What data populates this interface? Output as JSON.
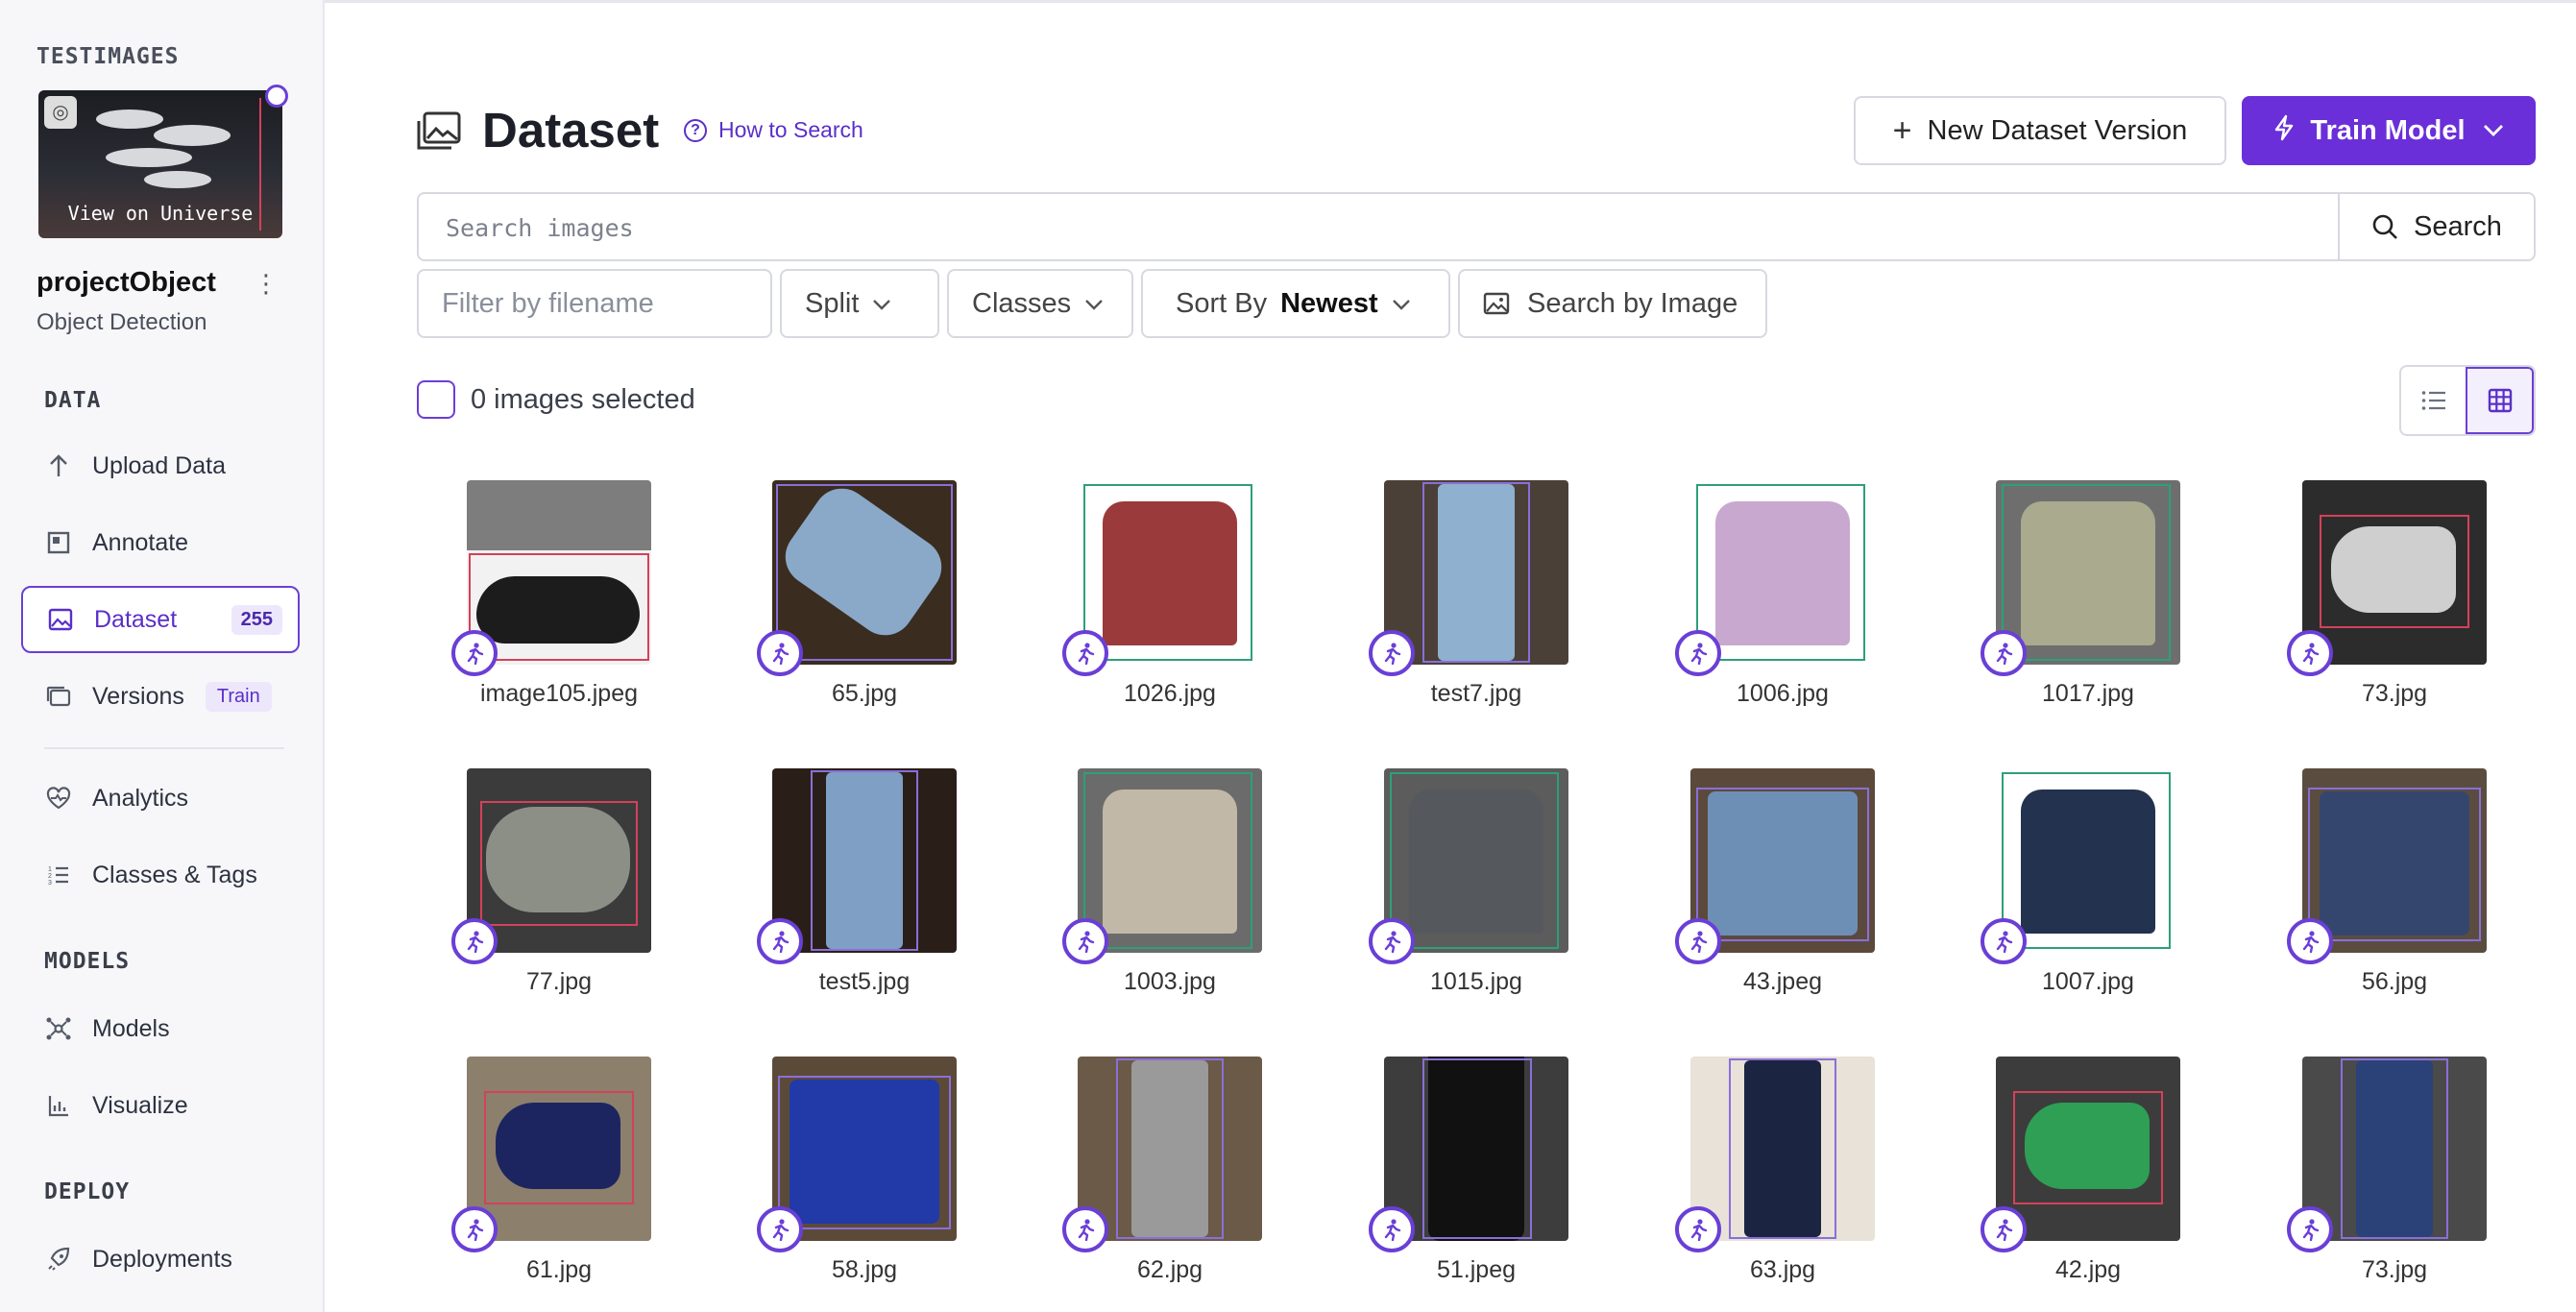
{
  "workspace": {
    "name": "TESTIMAGES",
    "view_label": "View on Universe"
  },
  "project": {
    "name": "projectObject",
    "type": "Object Detection"
  },
  "sidebar": {
    "sections": {
      "data": "DATA",
      "models": "MODELS",
      "deploy": "DEPLOY"
    },
    "items": [
      {
        "label": "Upload Data",
        "icon": "upload-icon"
      },
      {
        "label": "Annotate",
        "icon": "annotate-icon"
      },
      {
        "label": "Dataset",
        "icon": "dataset-icon",
        "badge": "255",
        "active": true
      },
      {
        "label": "Versions",
        "icon": "versions-icon",
        "badge": "Train"
      },
      {
        "label": "Analytics",
        "icon": "heartbeat-icon"
      },
      {
        "label": "Classes & Tags",
        "icon": "list-icon"
      },
      {
        "label": "Models",
        "icon": "network-icon"
      },
      {
        "label": "Visualize",
        "icon": "chart-icon"
      },
      {
        "label": "Deployments",
        "icon": "rocket-icon"
      }
    ]
  },
  "header": {
    "title": "Dataset",
    "help_link": "How to Search",
    "new_version_label": "New Dataset Version",
    "train_label": "Train Model"
  },
  "search": {
    "placeholder": "Search images",
    "button": "Search"
  },
  "filters": {
    "filename_placeholder": "Filter by filename",
    "split": "Split",
    "classes": "Classes",
    "sort_label": "Sort By",
    "sort_value": "Newest",
    "search_by_image": "Search by Image"
  },
  "selection": {
    "text": "0 images selected"
  },
  "accent_color": "#6a2fd9",
  "images": [
    {
      "name": "image105.jpeg",
      "bg": "#f2f2f2",
      "top": "#7d7d7d",
      "box": "#d4415a",
      "item": "#1c1c1c",
      "shape": "sandal"
    },
    {
      "name": "65.jpg",
      "bg": "#3a2c1e",
      "top": "#3a2c1e",
      "box": "#8a6fd8",
      "item": "#8aa8c8",
      "shape": "jeans-flat"
    },
    {
      "name": "1026.jpg",
      "bg": "#ffffff",
      "top": "#ffffff",
      "box": "#2e9f7a",
      "item": "#9b3a3a",
      "shape": "tee"
    },
    {
      "name": "test7.jpg",
      "bg": "#4b4038",
      "top": "#4b4038",
      "box": "#8a6fd8",
      "item": "#8fb0cf",
      "shape": "pants"
    },
    {
      "name": "1006.jpg",
      "bg": "#ffffff",
      "top": "#ffffff",
      "box": "#2e9f7a",
      "item": "#c8a8cf",
      "shape": "tee"
    },
    {
      "name": "1017.jpg",
      "bg": "#6e6e6e",
      "top": "#6e6e6e",
      "box": "#2e9f7a",
      "item": "#a9aa8e",
      "shape": "tee"
    },
    {
      "name": "73.jpg",
      "bg": "#2c2c2c",
      "top": "#2c2c2c",
      "box": "#d4415a",
      "item": "#cfcfcf",
      "shape": "shoe"
    },
    {
      "name": "77.jpg",
      "bg": "#3b3b3b",
      "top": "#3b3b3b",
      "box": "#d4415a",
      "item": "#8c8f86",
      "shape": "sandal2"
    },
    {
      "name": "test5.jpg",
      "bg": "#2a1f18",
      "top": "#2a1f18",
      "box": "#8a6fd8",
      "item": "#7f9fc4",
      "shape": "pants"
    },
    {
      "name": "1003.jpg",
      "bg": "#6b6b6b",
      "top": "#6b6b6b",
      "box": "#2e9f7a",
      "item": "#c2b8a8",
      "shape": "tee"
    },
    {
      "name": "1015.jpg",
      "bg": "#5c5c5c",
      "top": "#5c5c5c",
      "box": "#2e9f7a",
      "item": "#55585c",
      "shape": "tee"
    },
    {
      "name": "43.jpeg",
      "bg": "#5b4a3c",
      "top": "#5b4a3c",
      "box": "#8a6fd8",
      "item": "#6e8fb5",
      "shape": "shorts"
    },
    {
      "name": "1007.jpg",
      "bg": "#ffffff",
      "top": "#ffffff",
      "box": "#2e9f7a",
      "item": "#22324f",
      "shape": "tee"
    },
    {
      "name": "56.jpg",
      "bg": "#5a4d40",
      "top": "#5a4d40",
      "box": "#8a6fd8",
      "item": "#34466e",
      "shape": "shorts"
    },
    {
      "name": "61.jpg",
      "bg": "#8c7f6c",
      "top": "#8c7f6c",
      "box": "#d4415a",
      "item": "#1d2560",
      "shape": "shoe"
    },
    {
      "name": "58.jpg",
      "bg": "#5c4a39",
      "top": "#5c4a39",
      "box": "#8a6fd8",
      "item": "#2239a8",
      "shape": "shorts"
    },
    {
      "name": "62.jpg",
      "bg": "#6b5a47",
      "top": "#6b5a47",
      "box": "#8a6fd8",
      "item": "#9a9a9a",
      "shape": "pants"
    },
    {
      "name": "51.jpeg",
      "bg": "#3d3d3d",
      "top": "#3d3d3d",
      "box": "#8a6fd8",
      "item": "#111111",
      "shape": "skirt"
    },
    {
      "name": "63.jpg",
      "bg": "#e8e2d8",
      "top": "#e8e2d8",
      "box": "#8a6fd8",
      "item": "#1b2440",
      "shape": "pants"
    },
    {
      "name": "42.jpg",
      "bg": "#3c3c3c",
      "top": "#3c3c3c",
      "box": "#d4415a",
      "item": "#2e9f55",
      "shape": "shoe"
    },
    {
      "name": "73.jpg",
      "bg": "#4a4a4a",
      "top": "#4a4a4a",
      "box": "#8a6fd8",
      "item": "#2b4278",
      "shape": "pants"
    }
  ]
}
